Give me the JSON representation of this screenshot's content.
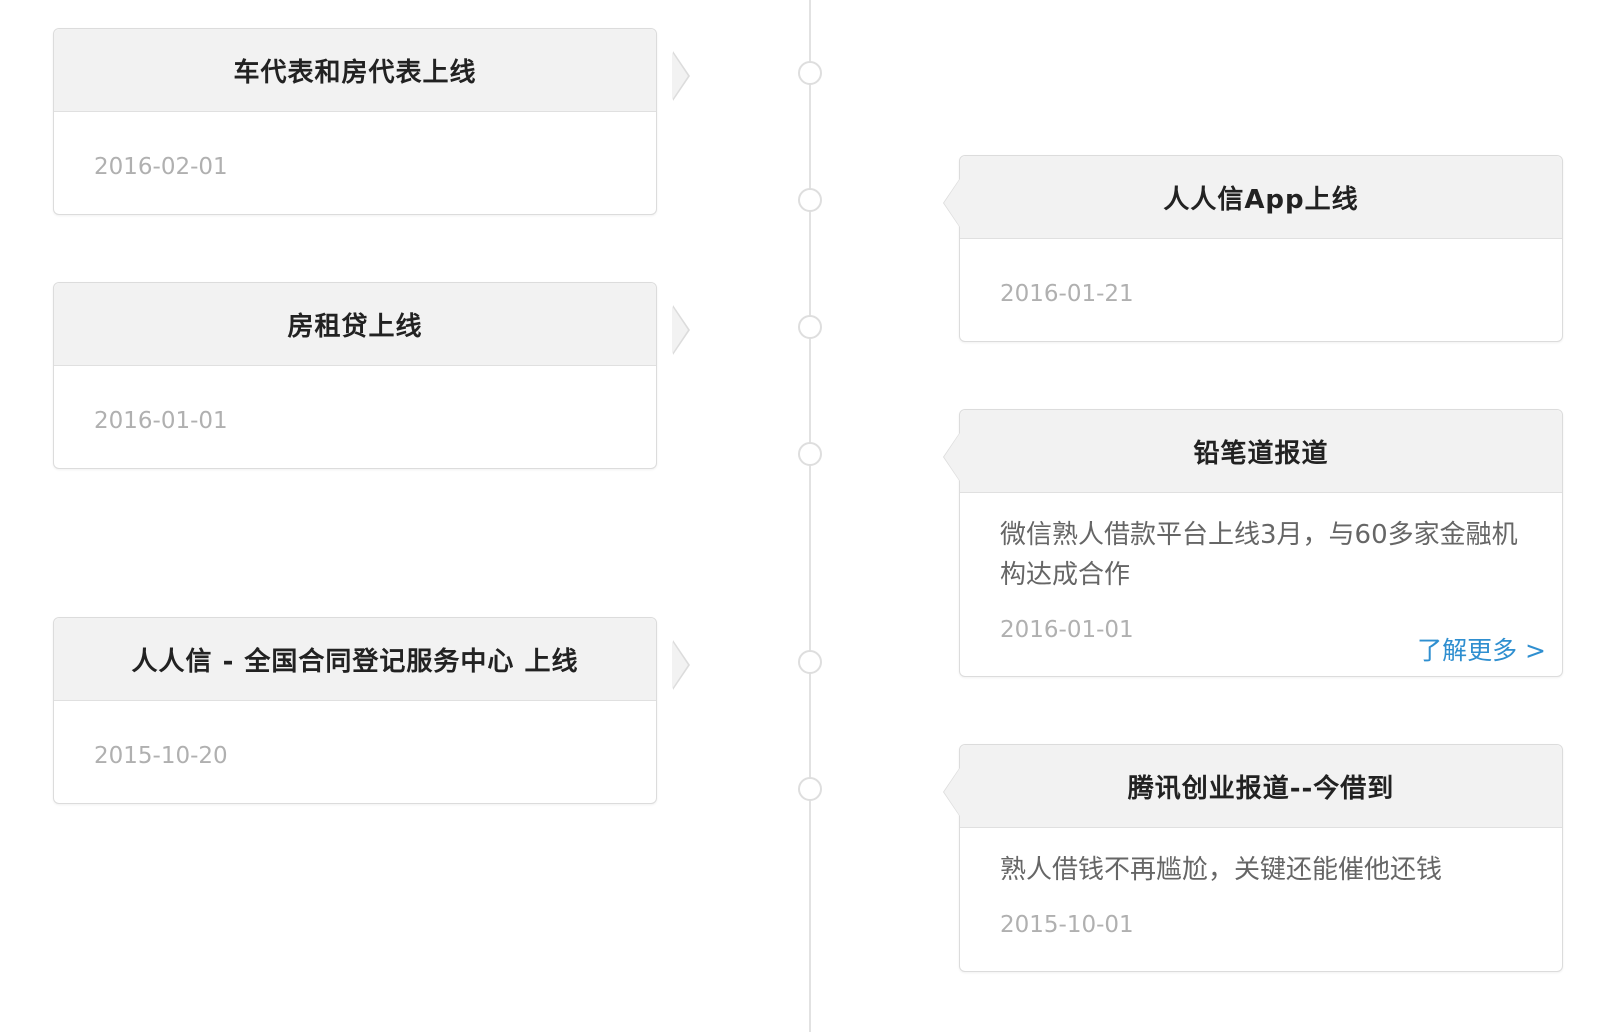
{
  "colors": {
    "line": "#e2e2e2",
    "header_bg": "#f2f2f2",
    "link": "#2f8fd0",
    "date": "#b0b0b0"
  },
  "events": [
    {
      "title": "车代表和房代表上线",
      "date": "2016-02-01"
    },
    {
      "title": "人人信App上线",
      "date": "2016-01-21"
    },
    {
      "title": "房租贷上线",
      "date": "2016-01-01"
    },
    {
      "title": "铅笔道报道",
      "description": "微信熟人借款平台上线3月，与60多家金融机构达成合作",
      "date": "2016-01-01",
      "more_label": "了解更多 >"
    },
    {
      "title": "人人信 - 全国合同登记服务中心 上线",
      "date": "2015-10-20"
    },
    {
      "title": "腾讯创业报道--今借到",
      "description": "熟人借钱不再尴尬，关键还能催他还钱",
      "date": "2015-10-01"
    }
  ]
}
